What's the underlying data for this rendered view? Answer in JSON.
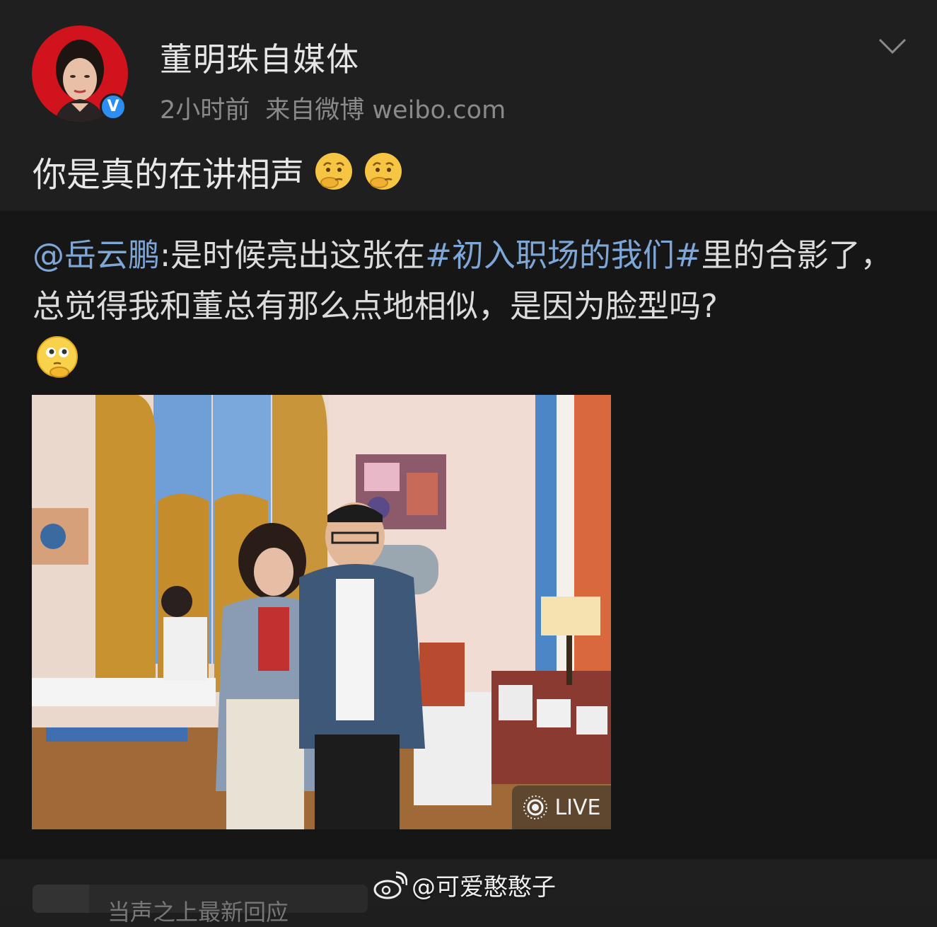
{
  "post": {
    "username": "董明珠自媒体",
    "time": "2小时前",
    "source": "来自微博 weibo.com",
    "text": "你是真的在讲相声",
    "text_emojis": [
      "thinking-emoji",
      "thinking-emoji"
    ],
    "verified_mark": "V"
  },
  "repost": {
    "mention": "@岳云鹏",
    "text_part1": ":是时候亮出这张在",
    "hashtag": "#初入职场的我们#",
    "text_part2": "里的合影了，总觉得我和董总有那么点地相似，是因为脸型吗?",
    "emoji": "thinking-emoji",
    "photo_badge": "LIVE"
  },
  "bottom": {
    "placeholder": "当声之上最新回应"
  },
  "watermark": {
    "text": "@可爱憨憨子"
  },
  "colors": {
    "link": "#7ea7d8",
    "verified": "#2b8ef0",
    "avatar_bg": "#d0131c",
    "background": "#1e1e1e"
  }
}
